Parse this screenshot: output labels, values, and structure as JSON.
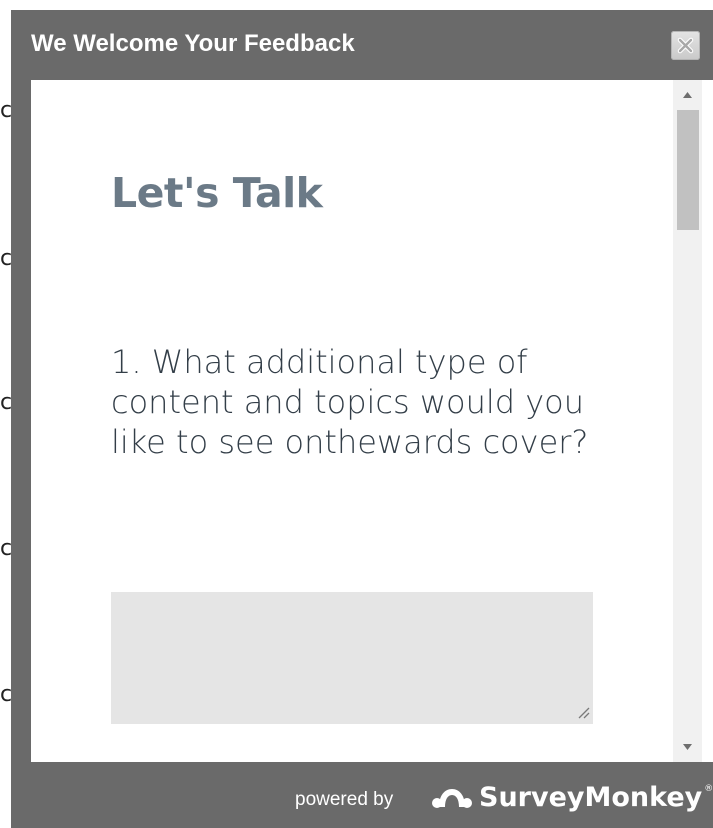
{
  "background": {
    "fragments": [
      "c",
      "c",
      "c",
      "c",
      "c"
    ]
  },
  "modal": {
    "title": "We Welcome Your Feedback",
    "close_icon": "close-icon"
  },
  "survey": {
    "heading": "Let's Talk",
    "question": "1. What additional type of content and topics would you like to see onthewards cover?",
    "answer_value": ""
  },
  "footer": {
    "powered_by": "powered by",
    "brand": "SurveyMonkey",
    "brand_mark": "®",
    "logo_icon": "surveymonkey-logo-icon"
  },
  "colors": {
    "modal_frame": "#6a6a6a",
    "heading": "#6b7a87",
    "question_text": "#333e48",
    "answer_box": "#e5e5e5",
    "scrollbar_track": "#f1f1f1",
    "scrollbar_thumb": "#c1c1c1"
  }
}
